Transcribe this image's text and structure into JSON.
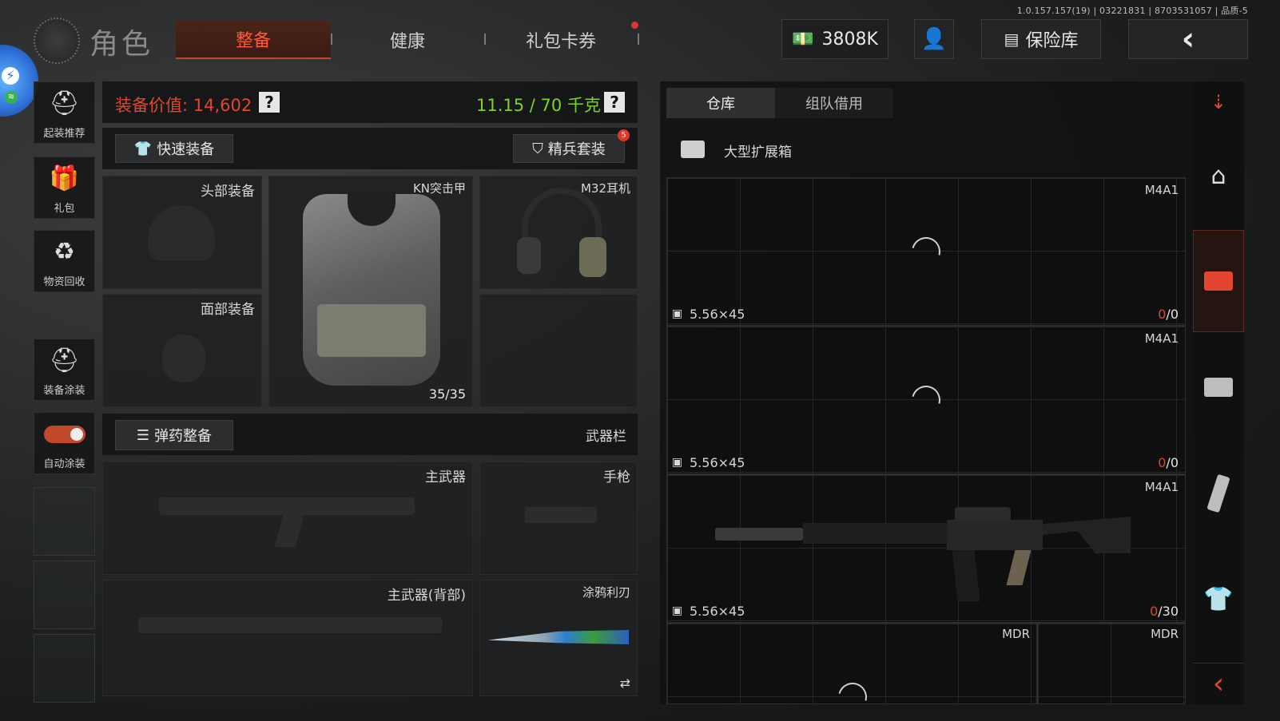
{
  "version": "1.0.157.157(19) | 03221831 | 8703531057 | 品质-5",
  "header": {
    "title": "角色",
    "tabs": [
      {
        "label": "整备",
        "active": true
      },
      {
        "label": "健康"
      },
      {
        "label": "礼包卡券",
        "dot": true
      }
    ],
    "currency": "3808K",
    "vault_label": "保险库"
  },
  "left_rail": [
    {
      "label": "起装推荐",
      "icon": "soldier-gear-icon"
    },
    {
      "label": "礼包",
      "icon": "gift-icon"
    },
    {
      "label": "物资回收",
      "icon": "recycle-icon"
    },
    {
      "label": "装备涂装",
      "icon": "paint-helmet-icon"
    },
    {
      "label": "自动涂装",
      "icon": "toggle-icon",
      "toggle_on": true
    }
  ],
  "equipment": {
    "value_label": "装备价值: 14,602",
    "weight": "11.15 / 70 千克",
    "quick_equip": "快速装备",
    "elite_set": "精兵套装",
    "elite_badge": "5",
    "slots": {
      "head": "头部装备",
      "armor": "KN突击甲",
      "armor_durability": "35/35",
      "headset": "M32耳机",
      "face": "面部装备"
    },
    "ammo_button": "弹药整备",
    "weapon_bar": "武器栏",
    "main_weapon": "主武器",
    "pistol": "手枪",
    "main_weapon_back": "主武器(背部)",
    "knife": "涂鸦利刃"
  },
  "warehouse": {
    "tabs": [
      {
        "label": "仓库",
        "active": true
      },
      {
        "label": "组队借用"
      }
    ],
    "container": "大型扩展箱",
    "items": [
      {
        "name": "M4A1",
        "ammo": "5.56×45",
        "loaded": "0",
        "capacity": "/0"
      },
      {
        "name": "M4A1",
        "ammo": "5.56×45",
        "loaded": "0",
        "capacity": "/0"
      },
      {
        "name": "M4A1",
        "ammo": "5.56×45",
        "loaded": "0",
        "capacity": "/30"
      },
      {
        "name": "MDR",
        "ammo": "",
        "loaded": "",
        "capacity": ""
      },
      {
        "name": "MDR",
        "ammo": "",
        "loaded": "",
        "capacity": ""
      }
    ]
  },
  "colors": {
    "accent": "#e2462f",
    "weight_green": "#7ed321",
    "value_red": "#e2462f"
  }
}
